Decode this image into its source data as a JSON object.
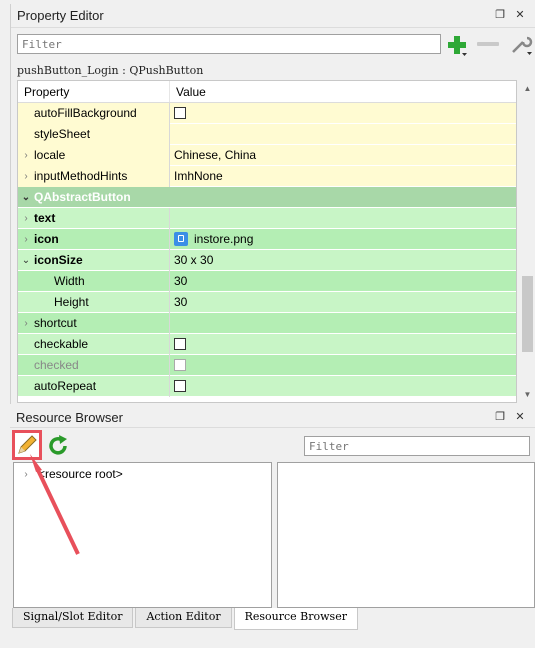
{
  "property_editor": {
    "title": "Property Editor",
    "filter_placeholder": "Filter",
    "object_name": "pushButton_Login : QPushButton",
    "header": {
      "property": "Property",
      "value": "Value"
    },
    "rows": [
      {
        "name": "autoFillBackground",
        "value": "",
        "type": "checkbox",
        "style": "yellow",
        "expander": ""
      },
      {
        "name": "styleSheet",
        "value": "",
        "type": "text",
        "style": "yellow",
        "expander": ""
      },
      {
        "name": "locale",
        "value": "Chinese, China",
        "type": "text",
        "style": "yellow",
        "expander": ">"
      },
      {
        "name": "inputMethodHints",
        "value": "ImhNone",
        "type": "text",
        "style": "yellow",
        "expander": ">"
      },
      {
        "name": "QAbstractButton",
        "value": "",
        "type": "group",
        "style": "group",
        "expander": "v"
      },
      {
        "name": "text",
        "value": "",
        "type": "text",
        "style": "green",
        "expander": ">"
      },
      {
        "name": "icon",
        "value": "instore.png",
        "type": "icon",
        "style": "green-d",
        "expander": ">"
      },
      {
        "name": "iconSize",
        "value": "30 x 30",
        "type": "text",
        "style": "green",
        "expander": "v"
      },
      {
        "name": "Width",
        "value": "30",
        "type": "text",
        "style": "green-d",
        "expander": ""
      },
      {
        "name": "Height",
        "value": "30",
        "type": "text",
        "style": "green",
        "expander": ""
      },
      {
        "name": "shortcut",
        "value": "",
        "type": "text",
        "style": "green-d",
        "expander": ">"
      },
      {
        "name": "checkable",
        "value": "",
        "type": "checkbox",
        "style": "green",
        "expander": ""
      },
      {
        "name": "checked",
        "value": "",
        "type": "checkbox-disabled",
        "style": "green-d",
        "expander": ""
      },
      {
        "name": "autoRepeat",
        "value": "",
        "type": "checkbox",
        "style": "green",
        "expander": ""
      }
    ]
  },
  "resource_browser": {
    "title": "Resource Browser",
    "filter_placeholder": "Filter",
    "tree_root": "<resource root>"
  },
  "tabs": [
    "Signal/Slot Editor",
    "Action Editor",
    "Resource Browser"
  ],
  "active_tab": 2,
  "colors": {
    "highlight_box": "#e8505b",
    "group_header": "#a8d8a8"
  }
}
